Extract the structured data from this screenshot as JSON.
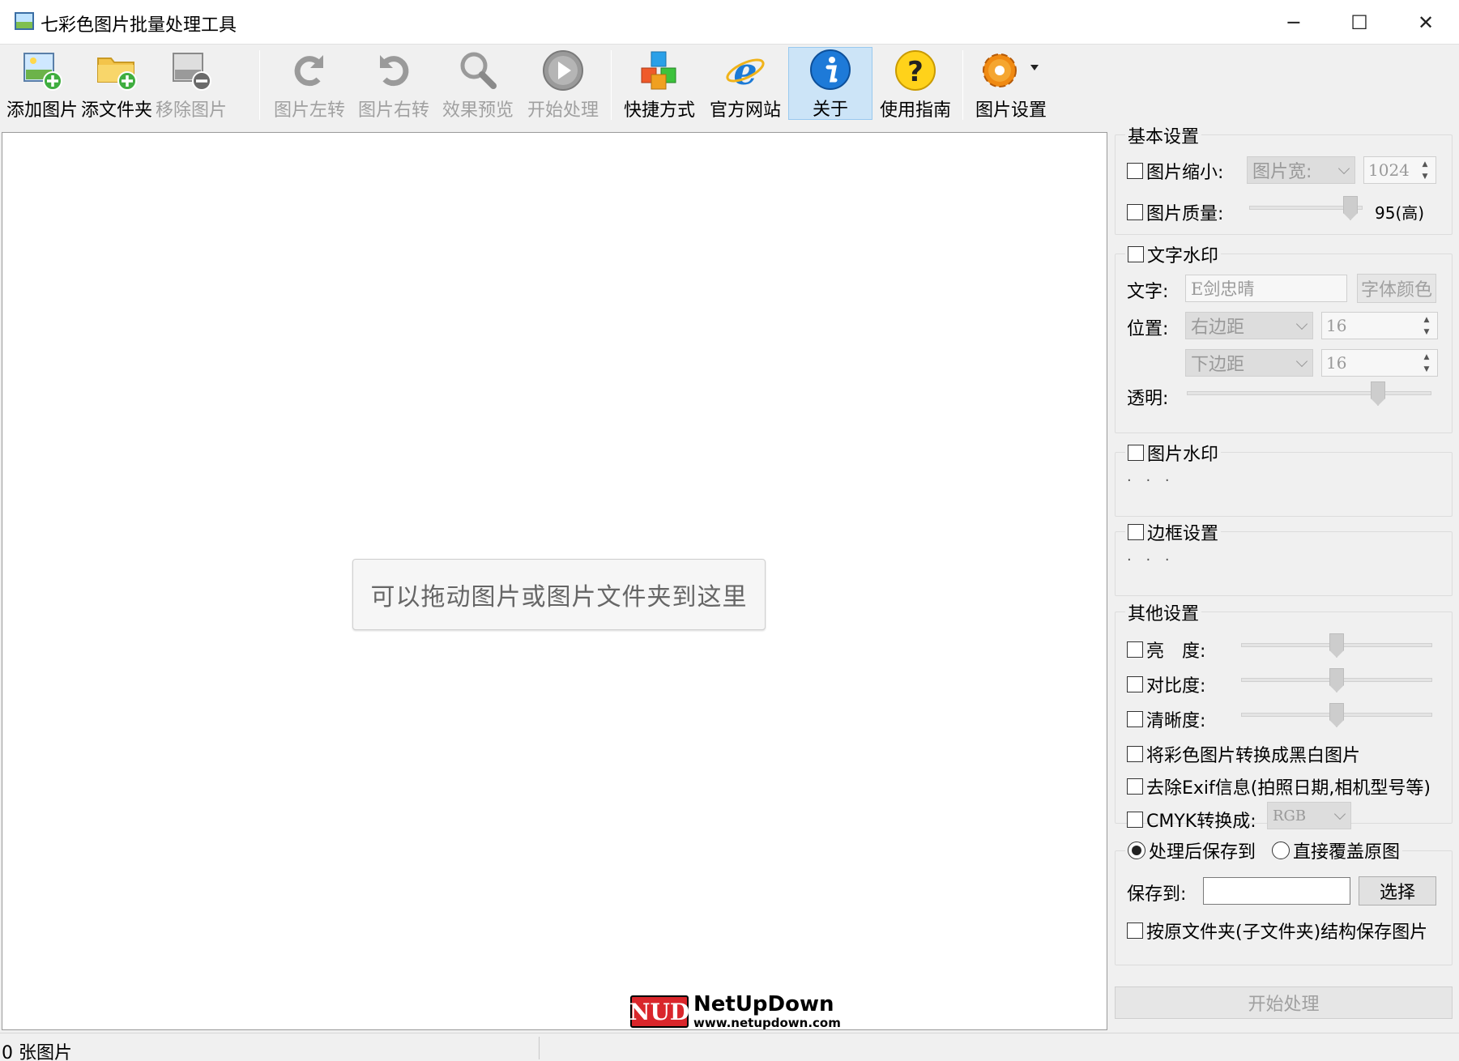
{
  "window": {
    "title": "七彩色图片批量处理工具",
    "controls": {
      "minimize": "─",
      "maximize": "☐",
      "close": "✕"
    }
  },
  "toolbar": {
    "items": [
      {
        "label": "添加图片",
        "icon": "add-image-icon",
        "enabled": true
      },
      {
        "label": "添文件夹",
        "icon": "add-folder-icon",
        "enabled": true
      },
      {
        "label": "移除图片",
        "icon": "remove-image-icon",
        "enabled": false
      },
      {
        "label": "图片左转",
        "icon": "rotate-left-icon",
        "enabled": false
      },
      {
        "label": "图片右转",
        "icon": "rotate-right-icon",
        "enabled": false
      },
      {
        "label": "效果预览",
        "icon": "magnifier-icon",
        "enabled": false
      },
      {
        "label": "开始处理",
        "icon": "play-icon",
        "enabled": false
      },
      {
        "label": "快捷方式",
        "icon": "cubes-icon",
        "enabled": true
      },
      {
        "label": "官方网站",
        "icon": "ie-icon",
        "enabled": true
      },
      {
        "label": "关于",
        "icon": "info-icon",
        "enabled": true,
        "active": true
      },
      {
        "label": "使用指南",
        "icon": "help-icon",
        "enabled": true
      },
      {
        "label": "图片设置",
        "icon": "gear-icon",
        "enabled": true,
        "has_dropdown": true
      }
    ]
  },
  "drop_area": {
    "hint": "可以拖动图片或图片文件夹到这里",
    "watermark": {
      "logo": "NUD",
      "name": "NetUpDown",
      "url": "www.netupdown.com"
    }
  },
  "status": {
    "count_text": "0 张图片"
  },
  "settings": {
    "basic": {
      "title": "基本设置",
      "resize": {
        "label": "图片缩小:",
        "checked": false,
        "mode": "图片宽:",
        "value": "1024"
      },
      "quality": {
        "label": "图片质量:",
        "checked": false,
        "value": 95,
        "max": 100,
        "display": "95(高)"
      }
    },
    "text_watermark": {
      "title": "文字水印",
      "checked": false,
      "text_label": "文字:",
      "text_value": "E剑忠晴",
      "font_color_button": "字体颜色",
      "position_label": "位置:",
      "h_mode": "右边距",
      "h_value": "16",
      "v_mode": "下边距",
      "v_value": "16",
      "opacity_label": "透明:",
      "opacity_level": 0.8
    },
    "image_watermark": {
      "title": "图片水印",
      "checked": false,
      "more": "· · ·"
    },
    "border": {
      "title": "边框设置",
      "checked": false,
      "more": "· · ·"
    },
    "other": {
      "title": "其他设置",
      "brightness": {
        "label": "亮　度:",
        "checked": false,
        "level": 0.5
      },
      "contrast": {
        "label": "对比度:",
        "checked": false,
        "level": 0.5
      },
      "sharpness": {
        "label": "清晰度:",
        "checked": false,
        "level": 0.5
      },
      "grayscale": {
        "label": "将彩色图片转换成黑白图片",
        "checked": false
      },
      "strip_exif": {
        "label": "去除Exif信息(拍照日期,相机型号等)",
        "checked": false
      },
      "cmyk": {
        "label": "CMYK转换成:",
        "checked": false,
        "value": "RGB"
      }
    },
    "output": {
      "save_to_option": "处理后保存到",
      "overwrite_option": "直接覆盖原图",
      "selected": "save_to",
      "path_label": "保存到:",
      "path_value": "",
      "choose_button": "选择",
      "keep_structure": {
        "label": "按原文件夹(子文件夹)结构保存图片",
        "checked": false
      }
    },
    "start_button": "开始处理"
  }
}
